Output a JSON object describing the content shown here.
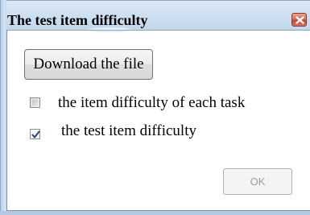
{
  "window": {
    "title": "The test item difficulty",
    "close_icon": "close-icon"
  },
  "actions": {
    "download_label": "Download the file",
    "ok_label": "OK",
    "ok_enabled": false
  },
  "options": [
    {
      "label": "the item difficulty of each task",
      "checked": false
    },
    {
      "label": "the test item difficulty",
      "checked": true
    }
  ],
  "colors": {
    "titlebar": "#cfe0f1",
    "close_button": "#c24a33",
    "checkmark": "#2b3f8c",
    "disabled_text": "#9c9c9c"
  }
}
